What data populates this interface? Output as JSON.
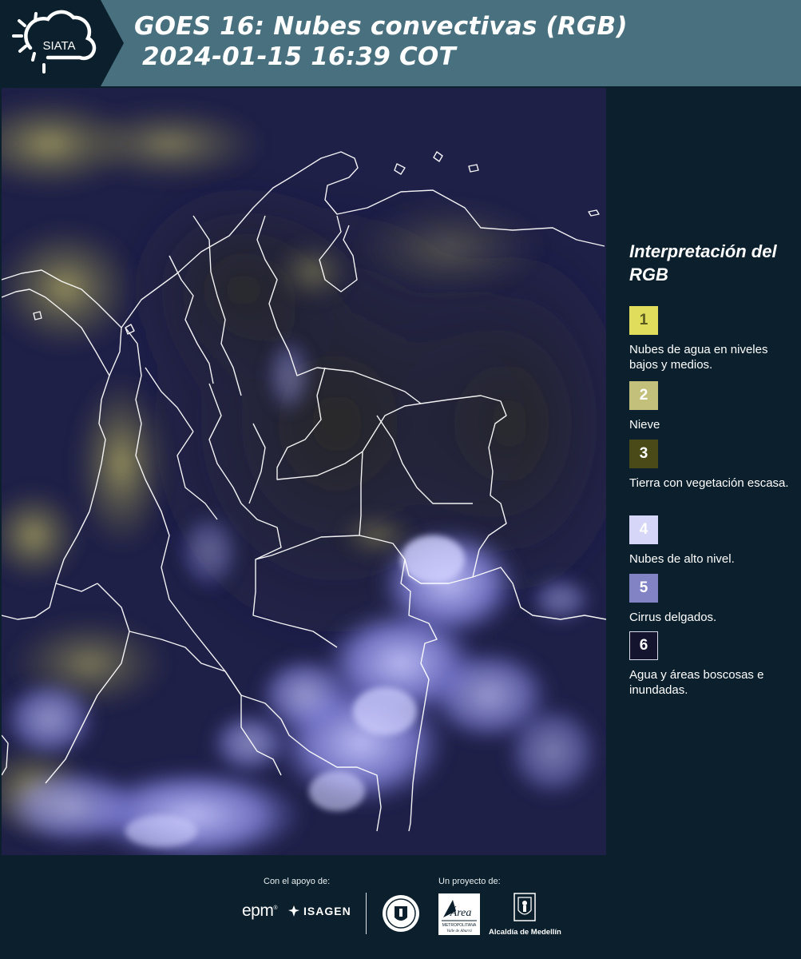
{
  "header": {
    "logo_text": "SIATA",
    "title_line1": "GOES 16: Nubes convectivas (RGB)",
    "title_line2": "2024-01-15 16:39 COT",
    "background_color": "#48707e"
  },
  "legend": {
    "title": "Interpretación del RGB",
    "items": [
      {
        "number": "1",
        "label": "Nubes de agua en niveles bajos y medios.",
        "color": "#e0dd5c",
        "text_color": "#5a5a20"
      },
      {
        "number": "2",
        "label": "Nieve",
        "color": "#c2c07a",
        "text_color": "#ffffff"
      },
      {
        "number": "3",
        "label": "Tierra con vegetación escasa.",
        "color": "#4a4a18",
        "text_color": "#ffffff"
      },
      {
        "number": "4",
        "label": "Nubes de alto nivel.",
        "color": "#d6d6f8",
        "text_color": "#ffffff"
      },
      {
        "number": "5",
        "label": "Cirrus delgados.",
        "color": "#8183c4",
        "text_color": "#ffffff"
      },
      {
        "number": "6",
        "label": "Agua y áreas boscosas e inundadas.",
        "color": "#14142e",
        "text_color": "#ffffff"
      }
    ]
  },
  "footer": {
    "support_label": "Con el apoyo de:",
    "project_label": "Un proyecto de:",
    "epm_text": "epm",
    "isagen_text": "ISAGEN",
    "area_logo_text": "Área",
    "area_sub1": "METROPOLITANA",
    "area_sub2": "Valle de Aburrá",
    "alcaldia_text": "Alcaldía de Medellín"
  },
  "map": {
    "description_colors": {
      "background": "#1e1f4a",
      "low_clouds": "#8f8a4e",
      "high_clouds": "#9c9cf2",
      "borders": "#ffffff"
    }
  }
}
